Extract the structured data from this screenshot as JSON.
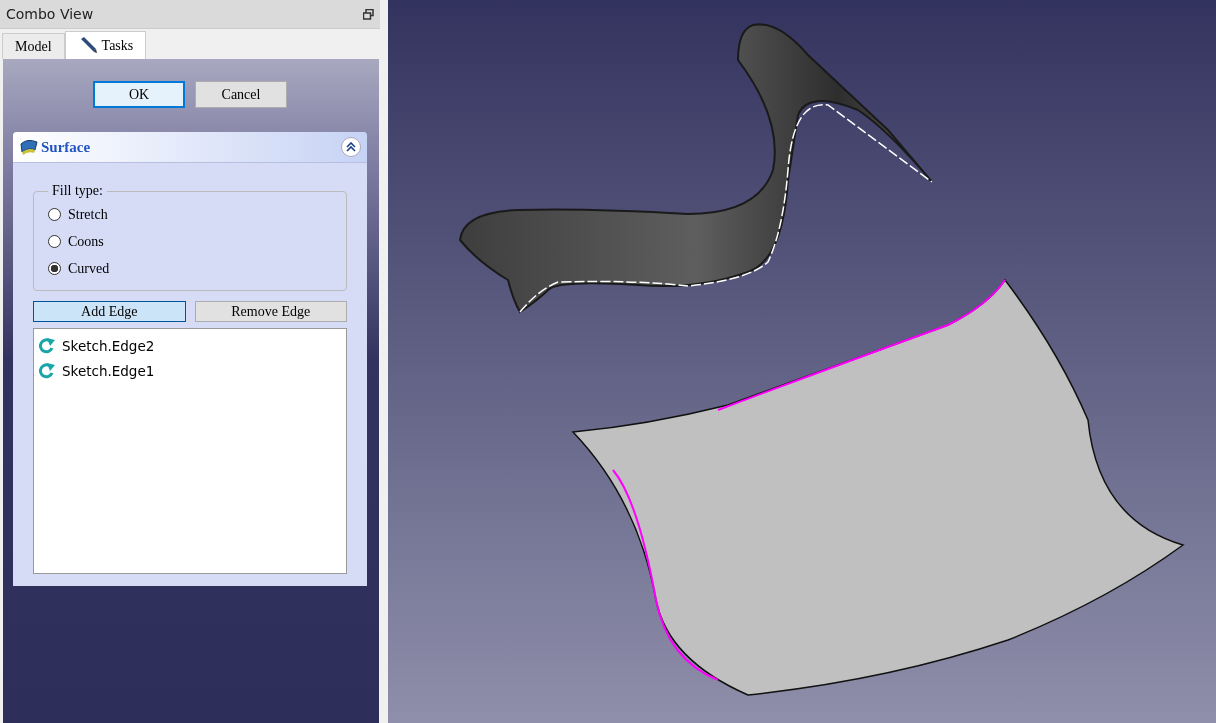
{
  "window": {
    "title": "Combo View"
  },
  "tabs": [
    {
      "label": "Model",
      "selected": false,
      "kind": "plain"
    },
    {
      "label": "Tasks",
      "selected": true,
      "kind": "pencil"
    }
  ],
  "dialog_buttons": [
    {
      "label": "OK",
      "selected": true
    },
    {
      "label": "Cancel",
      "selected": false
    }
  ],
  "panel": {
    "title": "Surface",
    "expanded": true
  },
  "fill_type": {
    "legend": "Fill type:",
    "options": [
      {
        "label": "Stretch",
        "selected": false
      },
      {
        "label": "Coons",
        "selected": false
      },
      {
        "label": "Curved",
        "selected": true
      }
    ]
  },
  "edge_buttons": [
    {
      "label": "Add Edge",
      "selected": true
    },
    {
      "label": "Remove Edge",
      "selected": false
    }
  ],
  "edges": [
    {
      "label": "Sketch.Edge2"
    },
    {
      "label": "Sketch.Edge1"
    }
  ]
}
